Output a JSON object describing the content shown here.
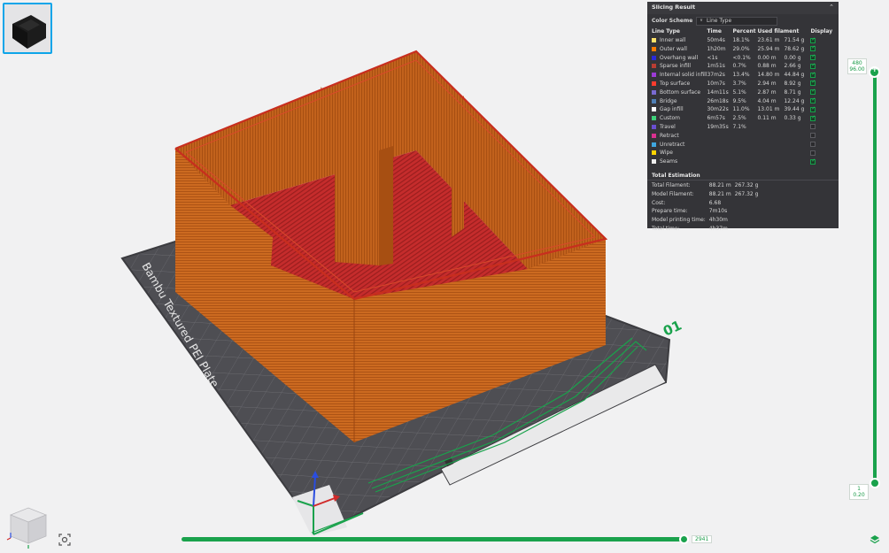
{
  "panel": {
    "title": "Slicing Result",
    "color_scheme_label": "Color Scheme",
    "color_scheme_value": "Line Type",
    "columns": [
      "Line Type",
      "Time",
      "Percent",
      "Used filament",
      "Display"
    ],
    "rows": [
      {
        "name": "Inner wall",
        "color": "#ffe26b",
        "time": "50m4s",
        "percent": "18.1%",
        "length": "23.61 m",
        "weight": "71.54 g",
        "on": true
      },
      {
        "name": "Outer wall",
        "color": "#ff7b00",
        "time": "1h20m",
        "percent": "29.0%",
        "length": "25.94 m",
        "weight": "78.62 g",
        "on": true
      },
      {
        "name": "Overhang wall",
        "color": "#2a2ad8",
        "time": "<1s",
        "percent": "<0.1%",
        "length": "0.00 m",
        "weight": "0.00 g",
        "on": true
      },
      {
        "name": "Sparse infill",
        "color": "#b83d33",
        "time": "1m51s",
        "percent": "0.7%",
        "length": "0.88 m",
        "weight": "2.66 g",
        "on": true
      },
      {
        "name": "Internal solid infill",
        "color": "#9c3bd6",
        "time": "37m2s",
        "percent": "13.4%",
        "length": "14.80 m",
        "weight": "44.84 g",
        "on": true
      },
      {
        "name": "Top surface",
        "color": "#ff3c2e",
        "time": "10m7s",
        "percent": "3.7%",
        "length": "2.94 m",
        "weight": "8.92 g",
        "on": true
      },
      {
        "name": "Bottom surface",
        "color": "#7a6ad1",
        "time": "14m11s",
        "percent": "5.1%",
        "length": "2.87 m",
        "weight": "8.71 g",
        "on": true
      },
      {
        "name": "Bridge",
        "color": "#4f7fb5",
        "time": "26m18s",
        "percent": "9.5%",
        "length": "4.04 m",
        "weight": "12.24 g",
        "on": true
      },
      {
        "name": "Gap infill",
        "color": "#ffffff",
        "time": "30m22s",
        "percent": "11.0%",
        "length": "13.01 m",
        "weight": "39.44 g",
        "on": true
      },
      {
        "name": "Custom",
        "color": "#3ed07a",
        "time": "6m57s",
        "percent": "2.5%",
        "length": "0.11 m",
        "weight": "0.33 g",
        "on": true
      },
      {
        "name": "Travel",
        "color": "#6a4ed1",
        "time": "19m35s",
        "percent": "7.1%",
        "length": "",
        "weight": "",
        "on": false
      },
      {
        "name": "Retract",
        "color": "#d9308f",
        "time": "",
        "percent": "",
        "length": "",
        "weight": "",
        "on": false
      },
      {
        "name": "Unretract",
        "color": "#3fa7e0",
        "time": "",
        "percent": "",
        "length": "",
        "weight": "",
        "on": false
      },
      {
        "name": "Wipe",
        "color": "#ffd400",
        "time": "",
        "percent": "",
        "length": "",
        "weight": "",
        "on": false
      },
      {
        "name": "Seams",
        "color": "#eeeeee",
        "time": "",
        "percent": "",
        "length": "",
        "weight": "",
        "on": true
      }
    ],
    "estimation_title": "Total Estimation",
    "estimation": [
      {
        "label": "Total Filament:",
        "value": "88.21 m",
        "value2": "267.32 g"
      },
      {
        "label": "Model Filament:",
        "value": "88.21 m",
        "value2": "267.32 g"
      },
      {
        "label": "Cost:",
        "value": "6.68",
        "value2": ""
      },
      {
        "label": "Prepare time:",
        "value": "7m10s",
        "value2": ""
      },
      {
        "label": "Model printing time:",
        "value": "4h30m",
        "value2": ""
      },
      {
        "label": "Total time:",
        "value": "4h37m",
        "value2": ""
      }
    ]
  },
  "plate": {
    "label": "Bambu Textured PEI Plate",
    "number": "01"
  },
  "layer_slider": {
    "top_layer": "480",
    "top_height": "96.00",
    "bottom_layer": "1",
    "bottom_height": "0.20"
  },
  "move_slider": {
    "value": "2941"
  },
  "colors": {
    "accent": "#1aa24c",
    "outer_wall": "#c8641a",
    "top_surface": "#c02a2a"
  }
}
